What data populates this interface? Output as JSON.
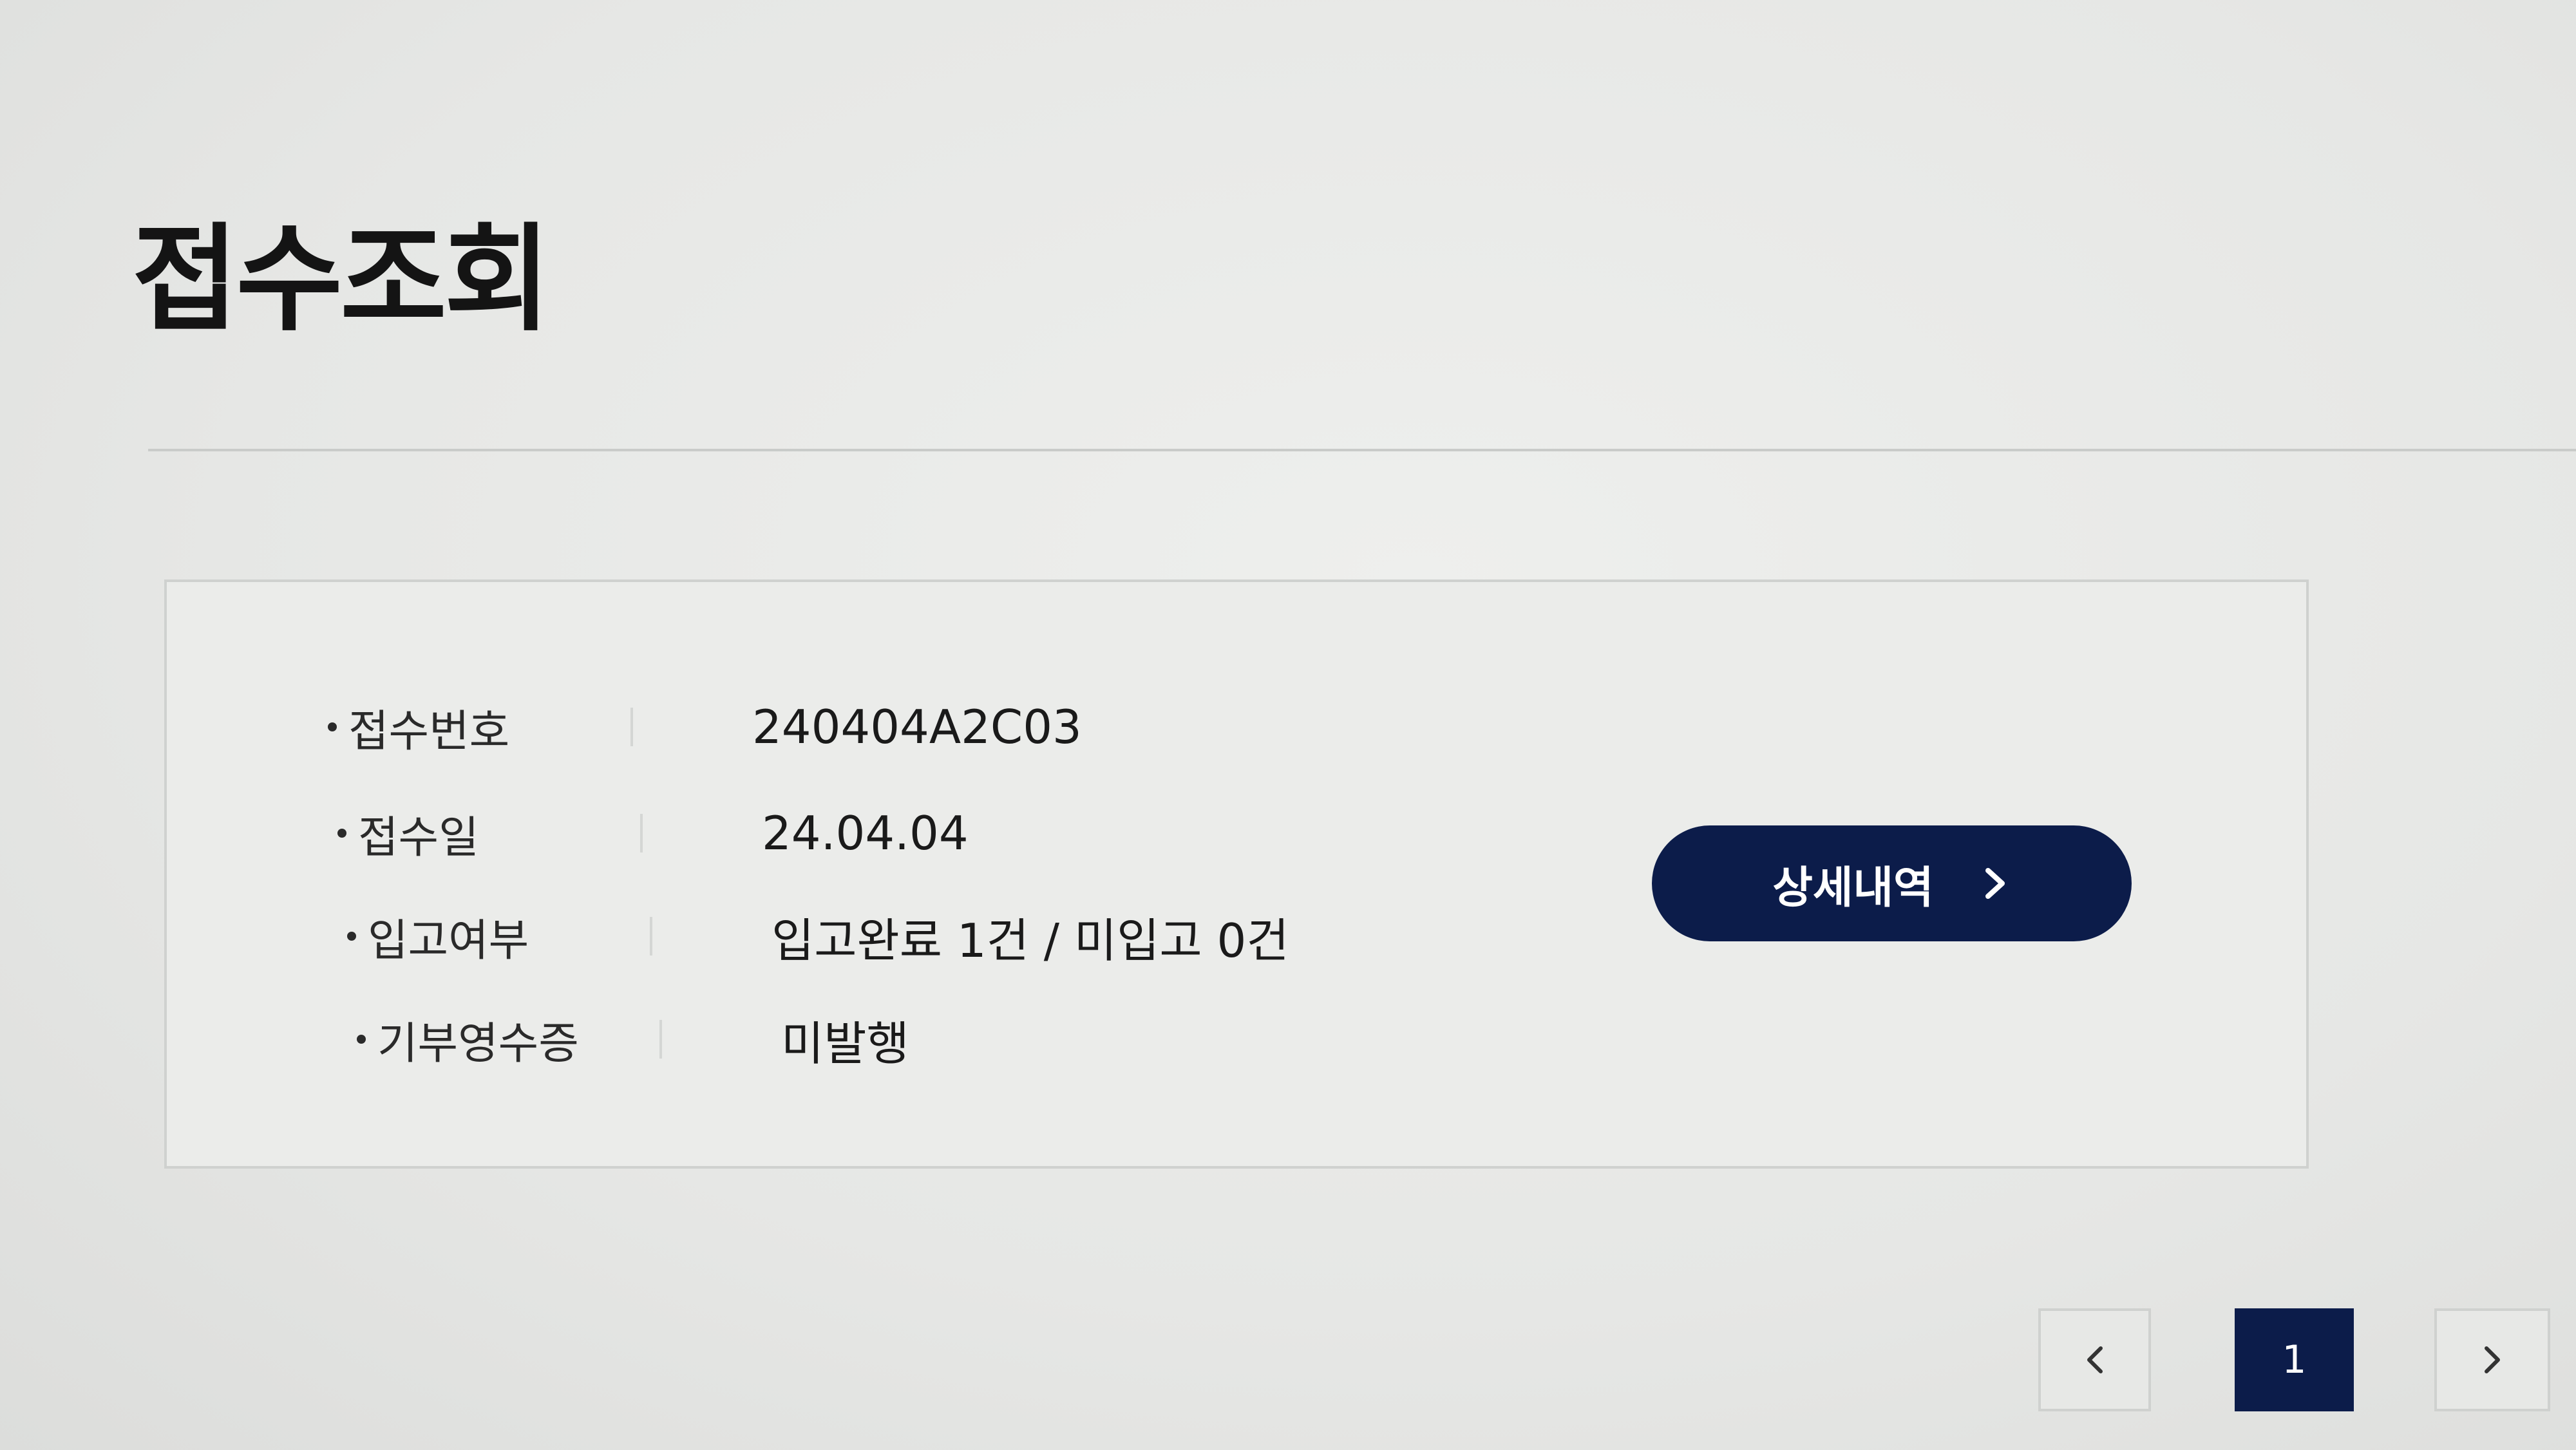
{
  "page": {
    "title": "접수조회"
  },
  "receipt": {
    "rows": [
      {
        "label": "접수번호",
        "value": "240404A2C03"
      },
      {
        "label": "접수일",
        "value": "24.04.04"
      },
      {
        "label": "입고여부",
        "value": "입고완료 1건 / 미입고 0건"
      },
      {
        "label": "기부영수증",
        "value": "미발행"
      }
    ]
  },
  "actions": {
    "detail_label": "상세내역"
  },
  "pagination": {
    "current_page": "1",
    "prev_icon": "chevron-left-icon",
    "next_icon": "chevron-right-icon"
  },
  "colors": {
    "accent": "#0c1c4a",
    "background": "#e7e8e6",
    "border": "#cfd1cf"
  }
}
